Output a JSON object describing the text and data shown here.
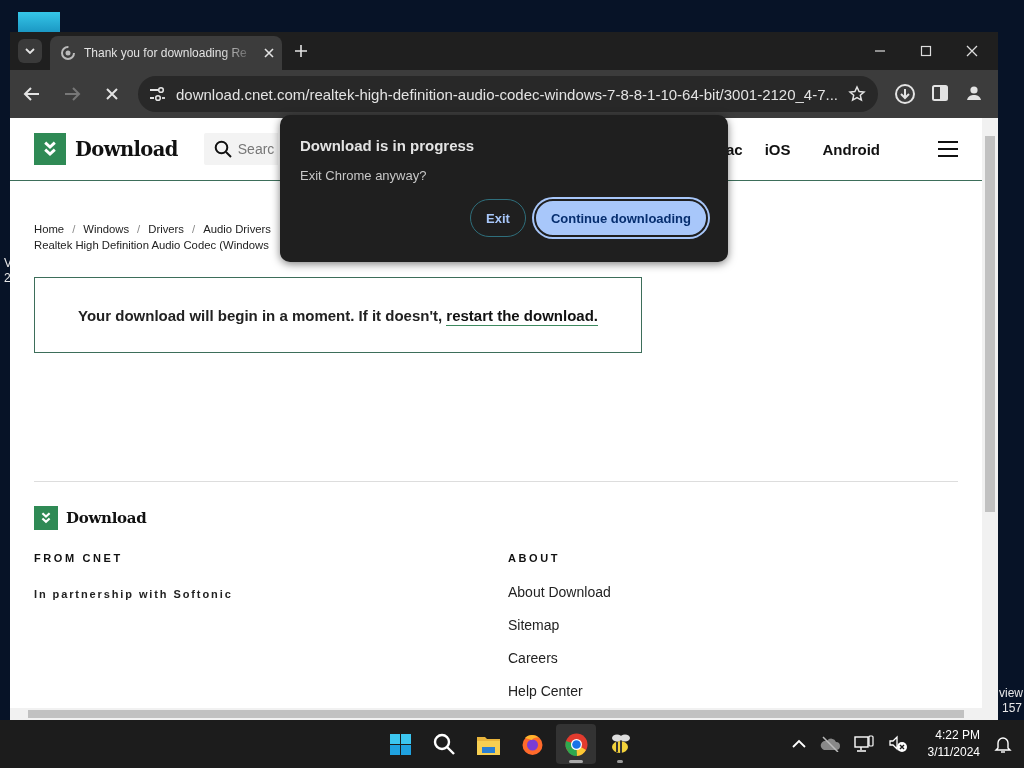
{
  "desktop": {
    "left_texts": [
      "V",
      "2"
    ],
    "right_texts": [
      "view",
      "157"
    ]
  },
  "tabs": [
    {
      "title": "Thank you for downloading Re",
      "selected": true
    }
  ],
  "address_bar": {
    "url": "download.cnet.com/realtek-high-definition-audio-codec-windows-7-8-8-1-10-64-bit/3001-2120_4-7...",
    "loading": true
  },
  "site_header": {
    "logo": "Download",
    "search": {
      "placeholder": "Searc"
    },
    "nav": [
      "ac",
      "iOS",
      "Android"
    ]
  },
  "breadcrumb": {
    "separator": "/",
    "items": [
      "Home",
      "Windows",
      "Drivers",
      "Audio Drivers"
    ],
    "current": "Realtek High Definition Audio Codec (Windows"
  },
  "notice": {
    "text": "Your download will begin in a moment. If it doesn't, ",
    "link": "restart the download."
  },
  "footer": {
    "logo": "Download",
    "columns": [
      {
        "heading": "FROM CNET",
        "links": [
          "In partnership with Softonic"
        ]
      },
      {
        "heading": "ABOUT",
        "links": [
          "About Download",
          "Sitemap",
          "Careers",
          "Help Center"
        ]
      }
    ]
  },
  "dialog": {
    "title": "Download is in progress",
    "message": "Exit Chrome anyway?",
    "buttons": [
      {
        "label": "Exit",
        "primary": false
      },
      {
        "label": "Continue downloading",
        "primary": true
      }
    ]
  },
  "taskbar": {
    "apps": [
      {
        "kind": "start",
        "selected": false,
        "running": false
      },
      {
        "kind": "search",
        "selected": false,
        "running": false
      },
      {
        "kind": "files",
        "selected": false,
        "running": false
      },
      {
        "kind": "firefox",
        "selected": false,
        "running": false
      },
      {
        "kind": "chrome",
        "selected": true,
        "running": true
      },
      {
        "kind": "bee",
        "selected": false,
        "running": true
      }
    ],
    "time": "4:22 PM",
    "date": "3/11/2024"
  }
}
